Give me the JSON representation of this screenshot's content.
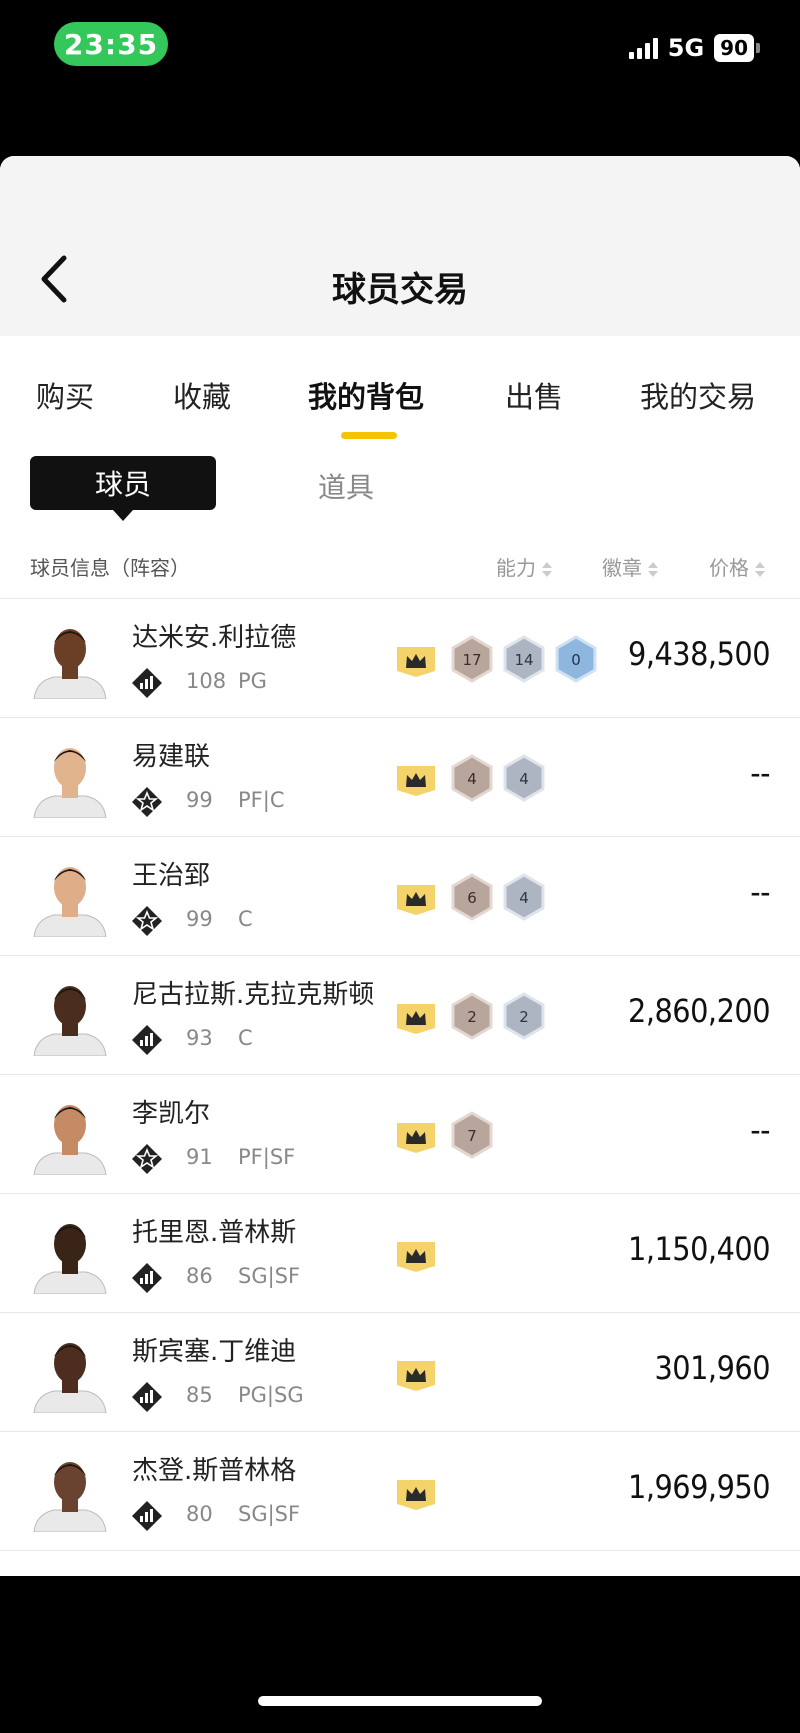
{
  "status_bar": {
    "time": "23:35",
    "network": "5G",
    "battery": "90"
  },
  "header": {
    "title": "球员交易"
  },
  "tabs": [
    "购买",
    "收藏",
    "我的背包",
    "出售",
    "我的交易"
  ],
  "active_tab": "我的背包",
  "subtabs": {
    "active": "球员",
    "inactive": "道具"
  },
  "columns": {
    "info": "球员信息（阵容）",
    "ability": "能力",
    "badge": "徽章",
    "price": "价格"
  },
  "colors": {
    "accent": "#f5c400",
    "dark": "#111111",
    "status_green": "#34c759"
  },
  "players": [
    {
      "name": "达米安.利拉德",
      "rank_icon": "bars-rank-icon",
      "ovr": "108",
      "pos": "PG",
      "badges": [
        {
          "v": "17",
          "type": "bronze"
        },
        {
          "v": "14",
          "type": "silver"
        },
        {
          "v": "0",
          "type": "blue"
        }
      ],
      "price": "9,438,500",
      "skin": "#6b3f26"
    },
    {
      "name": "易建联",
      "rank_icon": "star-rank-icon",
      "ovr": "99",
      "pos": "PF|C",
      "badges": [
        {
          "v": "4",
          "type": "bronze"
        },
        {
          "v": "4",
          "type": "silver"
        }
      ],
      "price": "--",
      "skin": "#e2b48e"
    },
    {
      "name": "王治郅",
      "rank_icon": "star-rank-icon",
      "ovr": "99",
      "pos": "C",
      "badges": [
        {
          "v": "6",
          "type": "bronze"
        },
        {
          "v": "4",
          "type": "silver"
        }
      ],
      "price": "--",
      "skin": "#dfae88"
    },
    {
      "name": "尼古拉斯.克拉克斯顿",
      "rank_icon": "bars-rank-icon",
      "ovr": "93",
      "pos": "C",
      "badges": [
        {
          "v": "2",
          "type": "bronze"
        },
        {
          "v": "2",
          "type": "silver"
        }
      ],
      "price": "2,860,200",
      "skin": "#4a2d1c"
    },
    {
      "name": "李凯尔",
      "rank_icon": "star-rank-icon",
      "ovr": "91",
      "pos": "PF|SF",
      "badges": [
        {
          "v": "7",
          "type": "bronze"
        }
      ],
      "price": "--",
      "skin": "#c58b64"
    },
    {
      "name": "托里恩.普林斯",
      "rank_icon": "bars-rank-icon",
      "ovr": "86",
      "pos": "SG|SF",
      "badges": [],
      "price": "1,150,400",
      "skin": "#3a2418"
    },
    {
      "name": "斯宾塞.丁维迪",
      "rank_icon": "bars-rank-icon",
      "ovr": "85",
      "pos": "PG|SG",
      "badges": [],
      "price": "301,960",
      "skin": "#4d2e1e"
    },
    {
      "name": "杰登.斯普林格",
      "rank_icon": "bars-rank-icon",
      "ovr": "80",
      "pos": "SG|SF",
      "badges": [],
      "price": "1,969,950",
      "skin": "#6a4330"
    }
  ]
}
